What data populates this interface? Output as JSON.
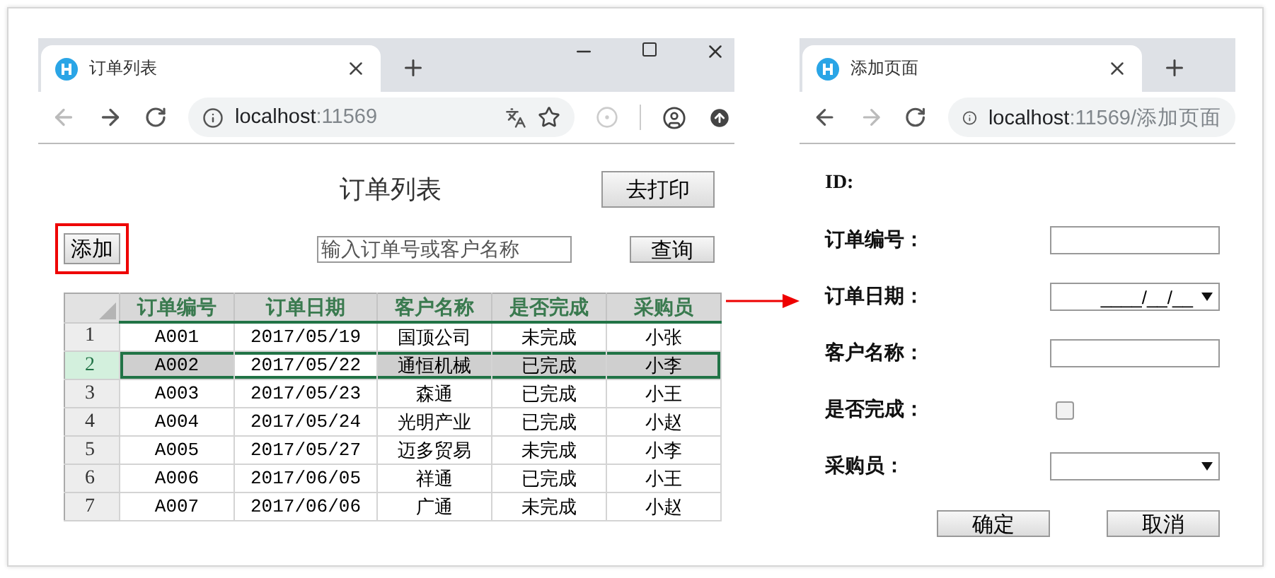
{
  "left_window": {
    "tab_title": "订单列表",
    "url_host": "localhost",
    "url_rest": ":11569",
    "back_enabled": false,
    "forward_enabled": true,
    "window_controls": true,
    "extensions": true
  },
  "order_list": {
    "title": "订单列表",
    "print_button": "去打印",
    "add_button": "添加",
    "add_highlighted": true,
    "search": {
      "placeholder": "输入订单号或客户名称"
    },
    "query_button": "查询",
    "table": {
      "columns": [
        "订单编号",
        "订单日期",
        "客户名称",
        "是否完成",
        "采购员"
      ],
      "rows": [
        {
          "number": "1",
          "selected": false,
          "cells": [
            {
              "text": "A001",
              "active": false
            },
            {
              "text": "2017/05/19",
              "active": false
            },
            {
              "text": "国顶公司",
              "active": false
            },
            {
              "text": "未完成",
              "active": false
            },
            {
              "text": "小张",
              "active": false
            }
          ]
        },
        {
          "number": "2",
          "selected": true,
          "cells": [
            {
              "text": "A002",
              "active": false
            },
            {
              "text": "2017/05/22",
              "active": true
            },
            {
              "text": "通恒机械",
              "active": false
            },
            {
              "text": "已完成",
              "active": false
            },
            {
              "text": "小李",
              "active": false
            }
          ]
        },
        {
          "number": "3",
          "selected": false,
          "cells": [
            {
              "text": "A003",
              "active": false
            },
            {
              "text": "2017/05/23",
              "active": false
            },
            {
              "text": "森通",
              "active": false
            },
            {
              "text": "已完成",
              "active": false
            },
            {
              "text": "小王",
              "active": false
            }
          ]
        },
        {
          "number": "4",
          "selected": false,
          "cells": [
            {
              "text": "A004",
              "active": false
            },
            {
              "text": "2017/05/24",
              "active": false
            },
            {
              "text": "光明产业",
              "active": false
            },
            {
              "text": "已完成",
              "active": false
            },
            {
              "text": "小赵",
              "active": false
            }
          ]
        },
        {
          "number": "5",
          "selected": false,
          "cells": [
            {
              "text": "A005",
              "active": false
            },
            {
              "text": "2017/05/27",
              "active": false
            },
            {
              "text": "迈多贸易",
              "active": false
            },
            {
              "text": "未完成",
              "active": false
            },
            {
              "text": "小李",
              "active": false
            }
          ]
        },
        {
          "number": "6",
          "selected": false,
          "cells": [
            {
              "text": "A006",
              "active": false
            },
            {
              "text": "2017/06/05",
              "active": false
            },
            {
              "text": "祥通",
              "active": false
            },
            {
              "text": "已完成",
              "active": false
            },
            {
              "text": "小王",
              "active": false
            }
          ]
        },
        {
          "number": "7",
          "selected": false,
          "cells": [
            {
              "text": "A007",
              "active": false
            },
            {
              "text": "2017/06/06",
              "active": false
            },
            {
              "text": "广通",
              "active": false
            },
            {
              "text": "未完成",
              "active": false
            },
            {
              "text": "小赵",
              "active": false
            }
          ]
        }
      ]
    }
  },
  "right_window": {
    "tab_title": "添加页面",
    "url_host": "localhost",
    "url_rest": ":11569/添加页面",
    "back_enabled": true,
    "forward_enabled": false,
    "window_controls": false,
    "extensions": false
  },
  "add_form": {
    "fields": [
      {
        "kind": "label",
        "label": "ID:"
      },
      {
        "kind": "text",
        "label": "订单编号："
      },
      {
        "kind": "date",
        "label": "订单日期：",
        "placeholder": "____/__/__"
      },
      {
        "kind": "text",
        "label": "客户名称："
      },
      {
        "kind": "checkbox",
        "label": "是否完成：",
        "checked": false
      },
      {
        "kind": "select",
        "label": "采购员："
      }
    ],
    "buttons": [
      "确定",
      "取消"
    ]
  }
}
